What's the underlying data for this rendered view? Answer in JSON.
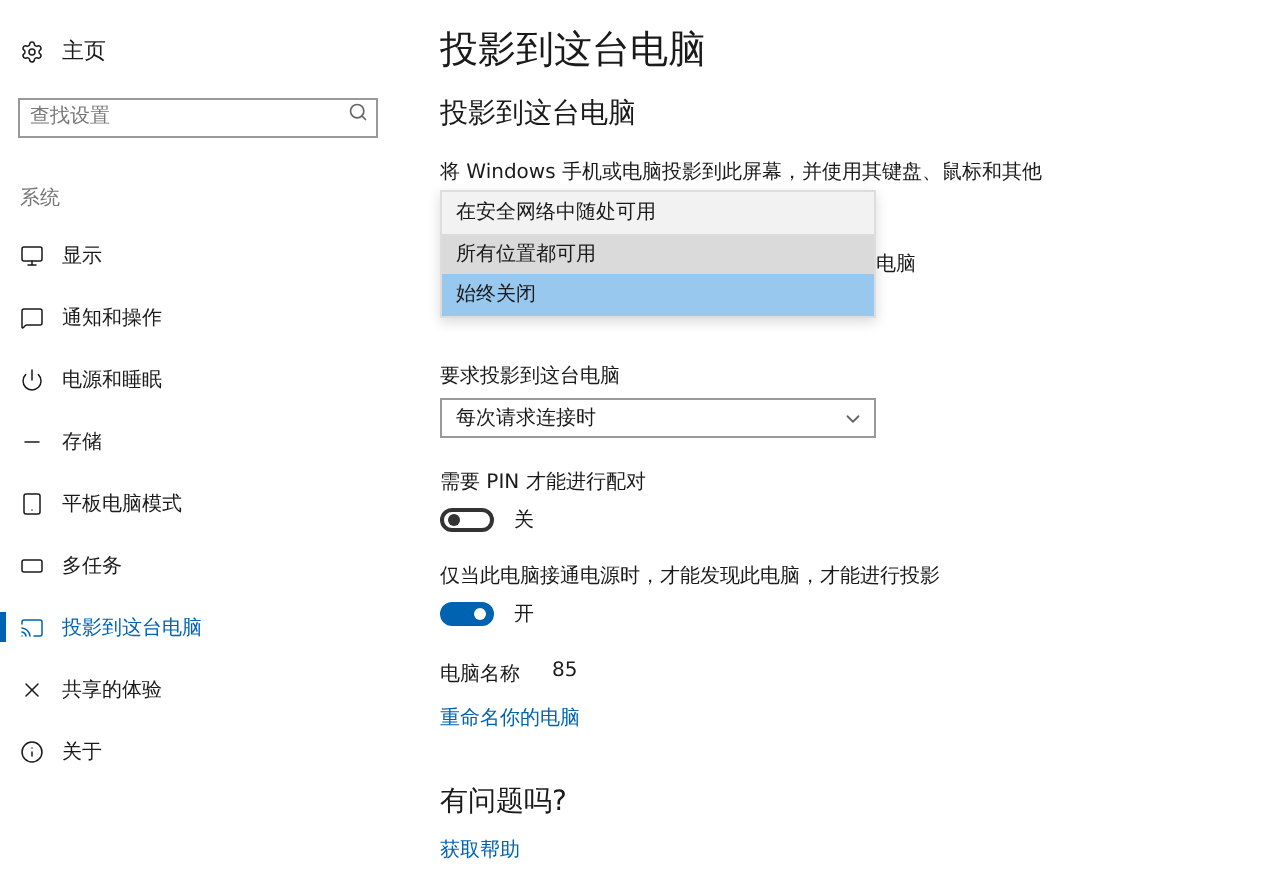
{
  "sidebar": {
    "home": "主页",
    "search": {
      "placeholder": "查找设置"
    },
    "section": "系统",
    "items": [
      {
        "label": "显示",
        "selected": false
      },
      {
        "label": "通知和操作",
        "selected": false
      },
      {
        "label": "电源和睡眠",
        "selected": false
      },
      {
        "label": "存储",
        "selected": false
      },
      {
        "label": "平板电脑模式",
        "selected": false
      },
      {
        "label": "多任务",
        "selected": false
      },
      {
        "label": "投影到这台电脑",
        "selected": true
      },
      {
        "label": "共享的体验",
        "selected": false
      },
      {
        "label": "关于",
        "selected": false
      }
    ]
  },
  "main": {
    "title": "投影到这台电脑",
    "subtitle": "投影到这台电脑",
    "description": "将 Windows 手机或电脑投影到此屏幕，并使用其键盘、鼠标和其他",
    "covered_text": "电脑",
    "dropdown_open": {
      "options": [
        {
          "label": "在安全网络中随处可用",
          "selected": false,
          "hover": false
        },
        {
          "label": "所有位置都可用",
          "selected": false,
          "hover": true
        },
        {
          "label": "始终关闭",
          "selected": true,
          "hover": false
        }
      ]
    },
    "request": {
      "label": "要求投影到这台电脑",
      "value": "每次请求连接时"
    },
    "toggles": [
      {
        "label": "需要 PIN 才能进行配对",
        "on": false,
        "state_text": "关"
      },
      {
        "label": "仅当此电脑接通电源时，才能发现此电脑，才能进行投影",
        "on": true,
        "state_text": "开"
      }
    ],
    "pc_name": {
      "label": "电脑名称",
      "value": "85"
    },
    "rename_link": "重命名你的电脑",
    "help": {
      "title": "有问题吗?",
      "link": "获取帮助"
    }
  }
}
